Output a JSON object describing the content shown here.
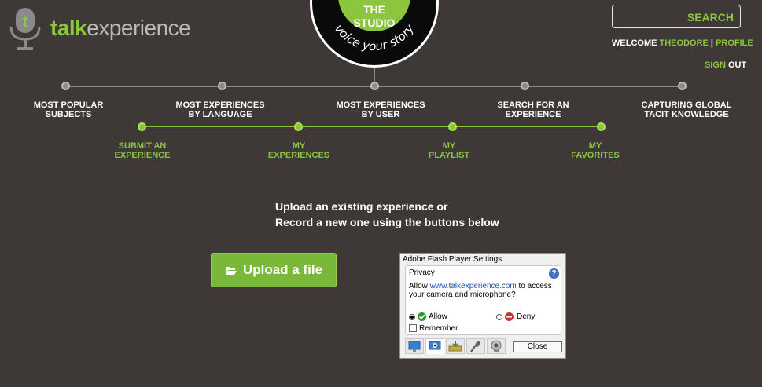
{
  "header": {
    "logo": {
      "word_talk": "talk",
      "word_experience": "experience"
    },
    "badge": {
      "line1": "THE",
      "line2": "STUDIO",
      "tagline": "voice your story"
    },
    "search_label": "SEARCH",
    "welcome": {
      "prefix": "WELCOME",
      "user": "THEODORE",
      "separator": "|",
      "profile": "PROFILE"
    },
    "signout": {
      "sign": "SIGN",
      "out": "OUT"
    }
  },
  "nav": {
    "top": [
      {
        "line1": "MOST POPULAR",
        "line2": "SUBJECTS"
      },
      {
        "line1": "MOST EXPERIENCES",
        "line2": "BY LANGUAGE"
      },
      {
        "line1": "MOST EXPERIENCES",
        "line2": "BY USER"
      },
      {
        "line1": "SEARCH FOR AN",
        "line2": "EXPERIENCE"
      },
      {
        "line1": "CAPTURING GLOBAL",
        "line2": "TACIT KNOWLEDGE"
      }
    ],
    "bottom": [
      {
        "line1": "SUBMIT AN",
        "line2": "EXPERIENCE"
      },
      {
        "line1": "MY",
        "line2": "EXPERIENCES"
      },
      {
        "line1": "MY",
        "line2": "PLAYLIST"
      },
      {
        "line1": "MY",
        "line2": "FAVORITES"
      }
    ]
  },
  "main": {
    "instruction_line1": "Upload an existing experience or",
    "instruction_line2": "Record a new one using the buttons below",
    "upload_button": "Upload a file"
  },
  "flash": {
    "title": "Adobe Flash Player Settings",
    "section": "Privacy",
    "help": "?",
    "text_prefix": "Allow ",
    "text_link": "www.talkexperience.com",
    "text_suffix": " to access your camera and microphone?",
    "allow_label": "Allow",
    "deny_label": "Deny",
    "remember_label": "Remember",
    "close_label": "Close",
    "allow_selected": true,
    "remember_checked": false
  },
  "colors": {
    "background": "#3e3937",
    "accent": "#8cc63f"
  }
}
